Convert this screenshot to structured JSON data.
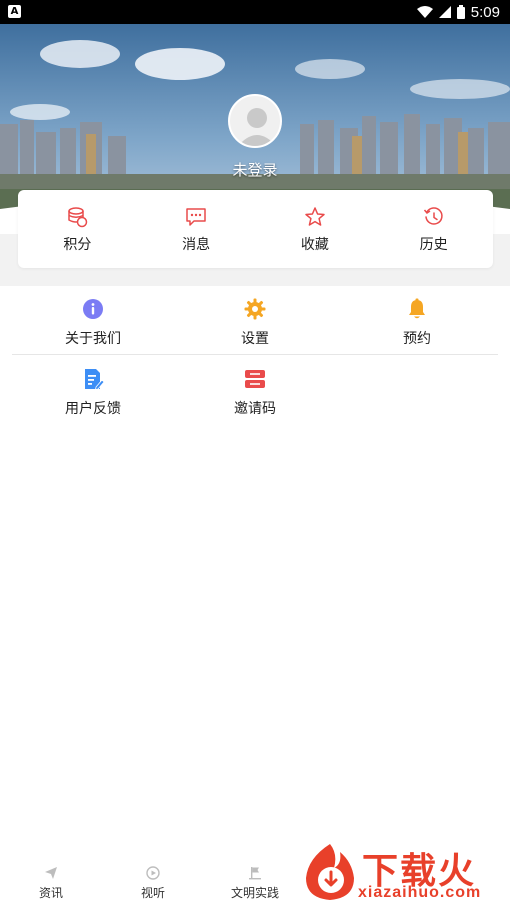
{
  "status_bar": {
    "time": "5:09"
  },
  "header": {
    "login_status": "未登录"
  },
  "quick_actions": [
    {
      "label": "积分",
      "icon": "coins-icon"
    },
    {
      "label": "消息",
      "icon": "message-icon"
    },
    {
      "label": "收藏",
      "icon": "star-icon"
    },
    {
      "label": "历史",
      "icon": "history-icon"
    }
  ],
  "menu": [
    {
      "label": "关于我们",
      "icon": "info-icon"
    },
    {
      "label": "设置",
      "icon": "gear-icon"
    },
    {
      "label": "预约",
      "icon": "bell-icon"
    },
    {
      "label": "用户反馈",
      "icon": "feedback-icon"
    },
    {
      "label": "邀请码",
      "icon": "invite-code-icon"
    }
  ],
  "bottom_nav": [
    {
      "label": "资讯",
      "icon": "paper-plane-icon"
    },
    {
      "label": "视听",
      "icon": "play-icon"
    },
    {
      "label": "文明实践",
      "icon": "flag-icon"
    }
  ],
  "watermark": {
    "brand": "下载火",
    "url": "xiazaihuo.com"
  },
  "colors": {
    "accent_red": "#e8402a",
    "icon_red": "#e94b4b",
    "info_purple": "#7b7cf4",
    "gear_orange": "#f5a623",
    "feedback_blue": "#3d8ef5"
  }
}
